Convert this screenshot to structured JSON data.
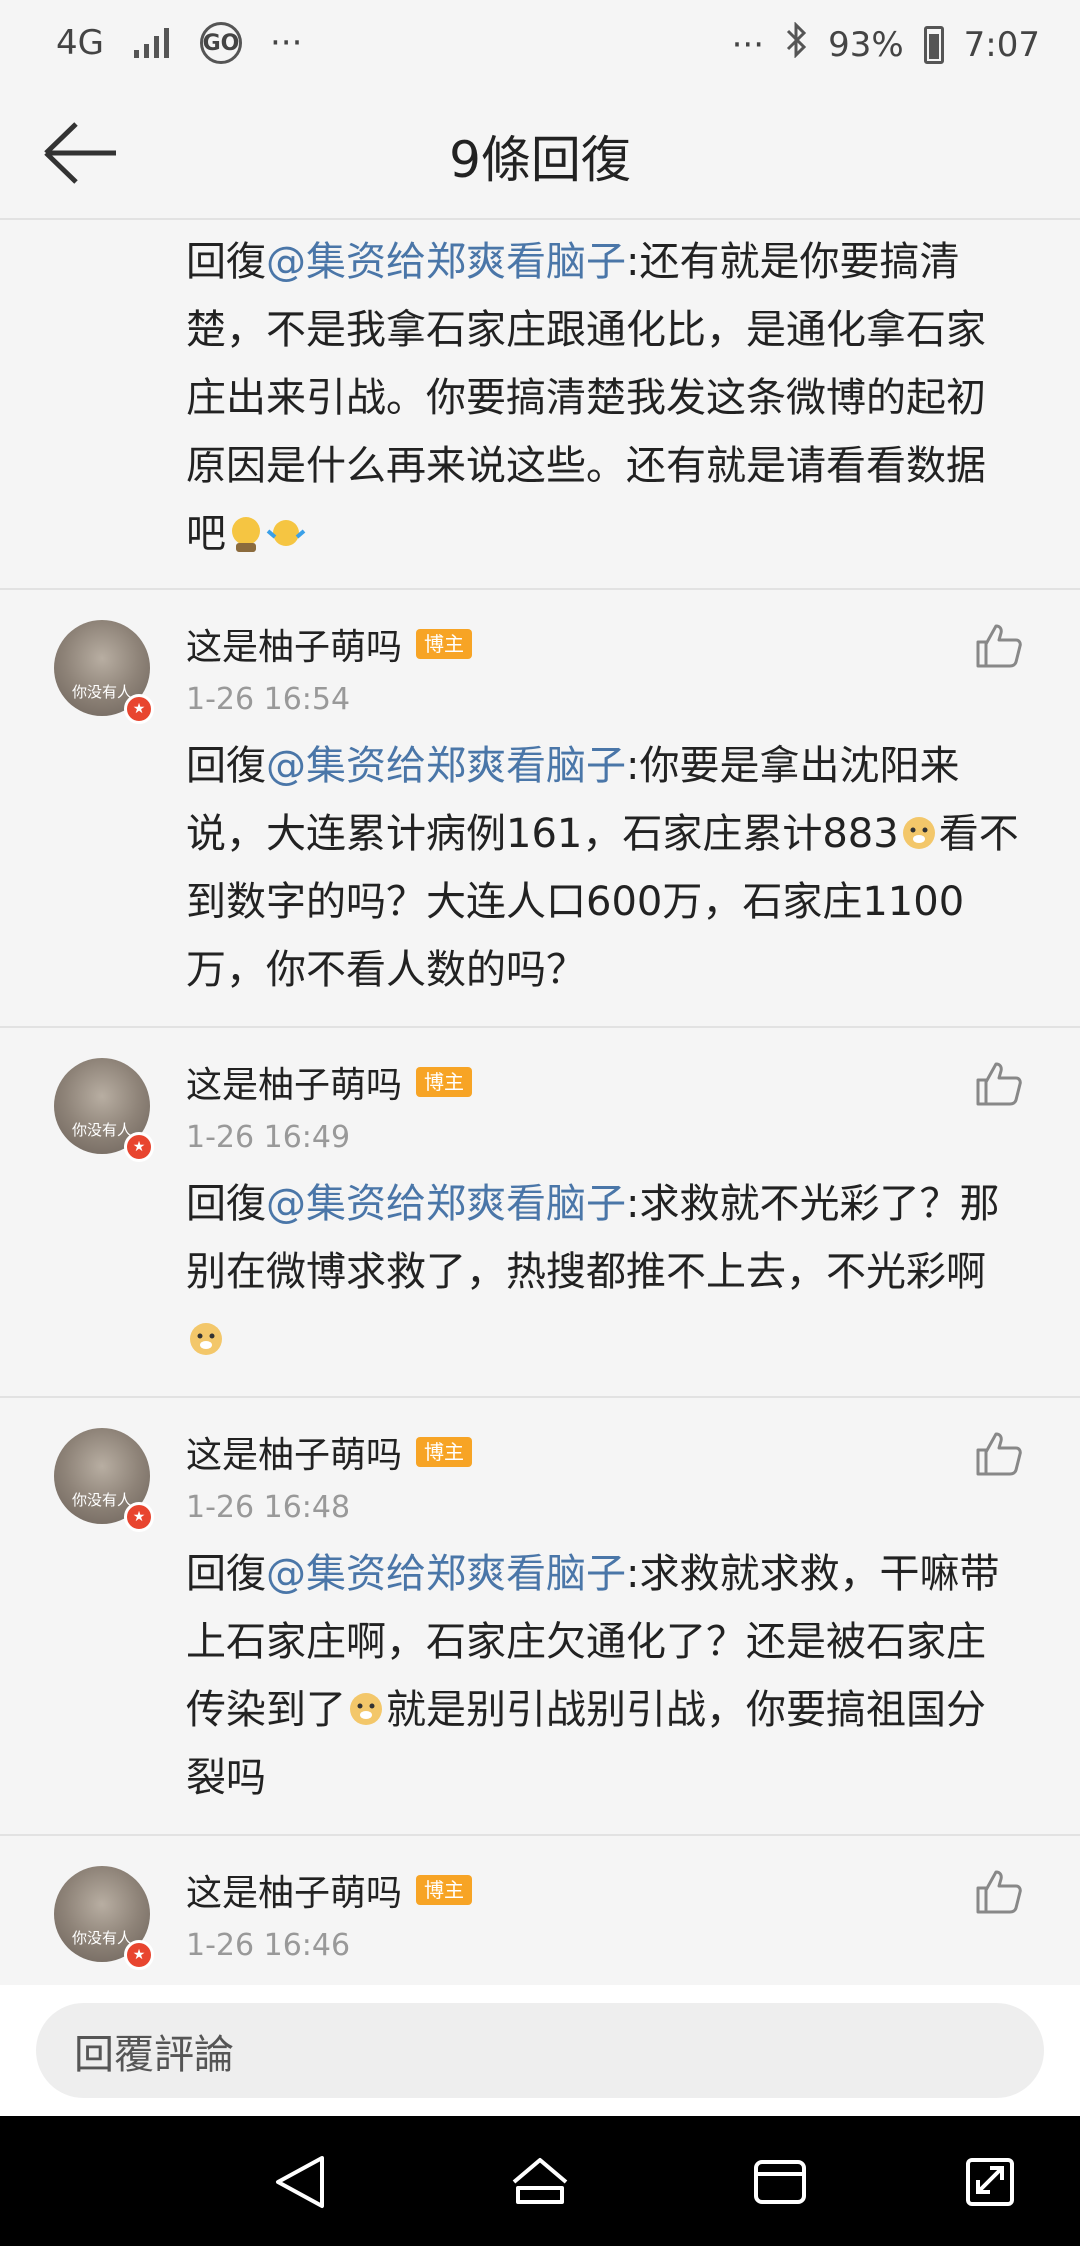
{
  "status_bar": {
    "network": "4G",
    "go_label": "GO",
    "more_left": "···",
    "more_right": "···",
    "battery": "93%",
    "time": "7:07"
  },
  "header": {
    "title": "9條回復"
  },
  "first_item": {
    "reply_prefix": "回復",
    "mention": "@集资给郑爽看脑子",
    "text": ":还有就是你要搞清楚，不是我拿石家庄跟通化比，是通化拿石家庄出来引战。你要搞清楚我发这条微博的起初原因是什么再来说这些。还有就是请看看数据吧"
  },
  "comments": [
    {
      "username": "这是柚子萌吗",
      "badge": "博主",
      "avatar_text": "你没有人",
      "time": "1-26 16:54",
      "reply_prefix": "回復",
      "mention": "@集资给郑爽看脑子",
      "text_a": ":你要是拿出沈阳来说，大连累计病例161，石家庄累计883",
      "text_b": "看不到数字的吗？大连人口600万，石家庄1100万，你不看人数的吗？"
    },
    {
      "username": "这是柚子萌吗",
      "badge": "博主",
      "avatar_text": "你没有人",
      "time": "1-26 16:49",
      "reply_prefix": "回復",
      "mention": "@集资给郑爽看脑子",
      "text_a": ":求救就不光彩了？那别在微博求救了，热搜都推不上去，不光彩啊",
      "text_b": ""
    },
    {
      "username": "这是柚子萌吗",
      "badge": "博主",
      "avatar_text": "你没有人",
      "time": "1-26 16:48",
      "reply_prefix": "回復",
      "mention": "@集资给郑爽看脑子",
      "text_a": ":求救就求救，干嘛带上石家庄啊，石家庄欠通化了？还是被石家庄传染到了",
      "text_b": "就是别引战别引战，你要搞祖国分裂吗"
    },
    {
      "username": "这是柚子萌吗",
      "badge": "博主",
      "avatar_text": "你没有人",
      "time": "1-26 16:46"
    }
  ],
  "reply_bar": {
    "placeholder": "回覆評論"
  },
  "icons": {
    "back": "back-arrow-icon",
    "like": "thumbs-up-icon",
    "emoji_dog": "doge-emoji-icon"
  },
  "colors": {
    "mention": "#4a76a8",
    "badge": "#f7a425",
    "verified": "#e8452f"
  }
}
